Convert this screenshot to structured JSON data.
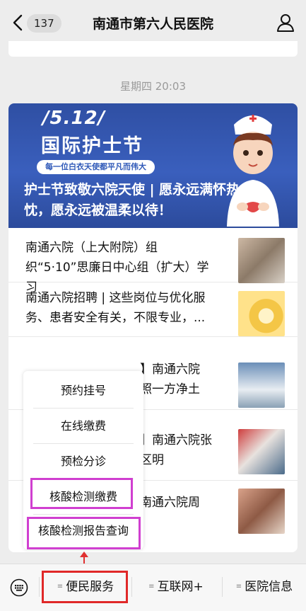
{
  "header": {
    "badge_count": "137",
    "title": "南通市第六人民医院"
  },
  "timestamp": "星期四 20:03",
  "banner": {
    "date": "/5.12/",
    "festival": "国际护士节",
    "slogan": "每一位白衣天使都平凡而伟大",
    "headline": "护士节致敬六院天使 | 愿永远满怀热忱，愿永远被温柔以待！"
  },
  "articles": [
    {
      "title": "南通六院（上大附院）组织“5·10”思廉日中心组（扩大）学习"
    },
    {
      "title": "南通六院招聘 | 这些岗位与优化服务、患者安全有关，不限专业，..."
    },
    {
      "title_visible": "】南通六院",
      "title_line2": "照一方净土"
    },
    {
      "title_visible": "】南通六院张",
      "title_line2": "区明"
    },
    {
      "title_visible": "南通六院周"
    }
  ],
  "popup_menu": {
    "items": [
      "预约挂号",
      "在线缴费",
      "预检分诊",
      "核酸检测缴费",
      "核酸检测报告查询"
    ]
  },
  "bottom_tabs": [
    {
      "label": "便民服务"
    },
    {
      "label": "互联网+"
    },
    {
      "label": "医院信息"
    }
  ],
  "colors": {
    "highlight_magenta": "#d03fd0",
    "highlight_red": "#e02828",
    "banner_blue": "#2f4fa3"
  }
}
